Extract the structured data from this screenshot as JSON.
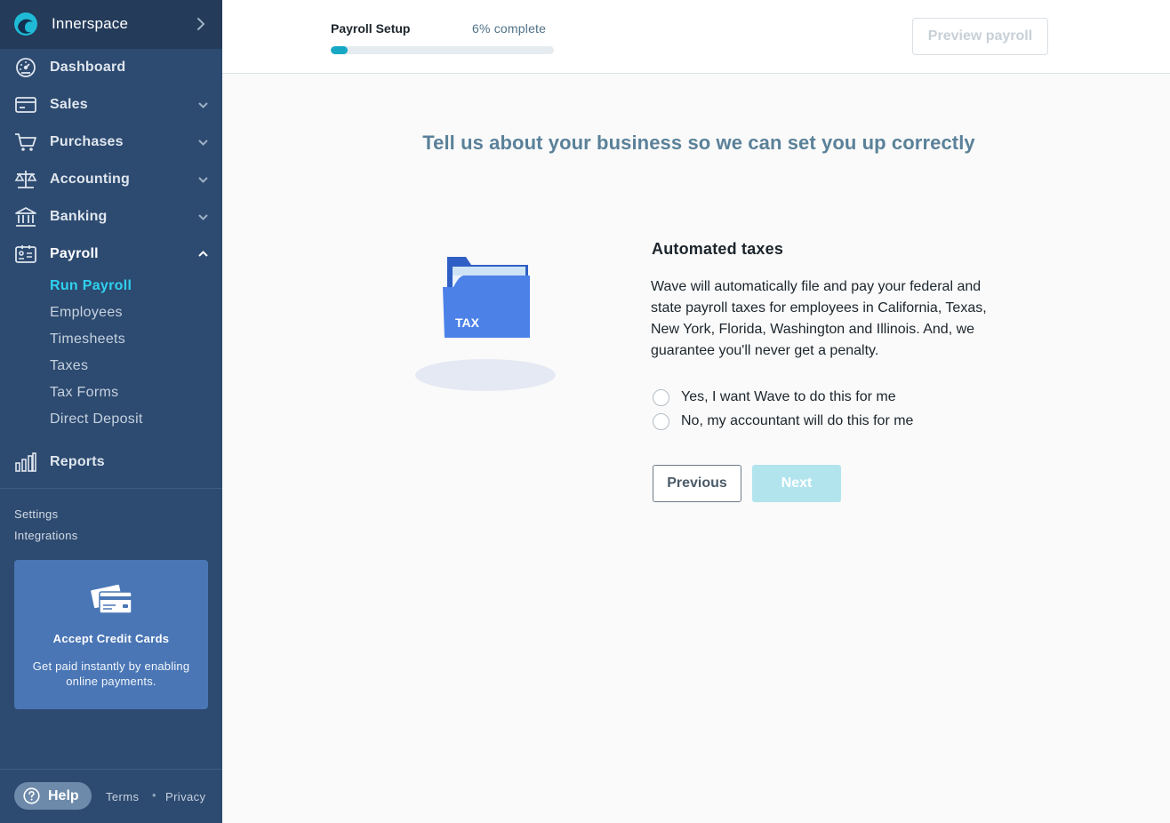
{
  "business": {
    "name": "Innerspace",
    "logo_icon": "wave-logo-icon",
    "switch_icon": "chevron-right-icon"
  },
  "nav": {
    "items": [
      {
        "label": "Dashboard",
        "icon": "dashboard-icon"
      },
      {
        "label": "Sales",
        "icon": "sales-card-icon"
      },
      {
        "label": "Purchases",
        "icon": "cart-icon"
      },
      {
        "label": "Accounting",
        "icon": "scale-icon"
      },
      {
        "label": "Banking",
        "icon": "bank-icon"
      },
      {
        "label": "Payroll",
        "icon": "id-card-icon"
      },
      {
        "label": "Reports",
        "icon": "bar-chart-icon"
      }
    ],
    "payroll_sub": [
      "Run Payroll",
      "Employees",
      "Timesheets",
      "Taxes",
      "Tax Forms",
      "Direct Deposit"
    ],
    "current_sub": "Run Payroll"
  },
  "sidebar_links": {
    "settings": "Settings",
    "integrations": "Integrations"
  },
  "promo": {
    "title": "Accept Credit Cards",
    "text": "Get paid instantly by enabling online payments.",
    "icon": "credit-cards-icon"
  },
  "footer": {
    "help": "Help",
    "terms": "Terms",
    "separator": "•",
    "privacy": "Privacy"
  },
  "header": {
    "step_label": "Payroll Setup",
    "percent_text": "6% complete",
    "progress": 0.075,
    "preview_label": "Preview payroll"
  },
  "main": {
    "headline": "Tell us about your business so we can set you up correctly",
    "illustration": {
      "folder_label": "TAX",
      "icon": "tax-folder-icon"
    },
    "question_title": "Automated taxes",
    "question_body": "Wave will automatically file and pay your federal and state payroll taxes for employees in California, Texas, New York, Florida, Washington and Illinois. And, we guarantee you'll never get a penalty.",
    "options": [
      "Yes, I want Wave to do this for me",
      "No, my accountant will do this for me"
    ],
    "previous_label": "Previous",
    "next_label": "Next"
  },
  "colors": {
    "sidebar": "#2d4a70",
    "sidebar_header": "#243b5a",
    "active_sub": "#2fd2ef",
    "progress": "#16a8c4",
    "headline": "#5a8199",
    "promo": "#4a76b5",
    "folder": "#4c82e8"
  }
}
